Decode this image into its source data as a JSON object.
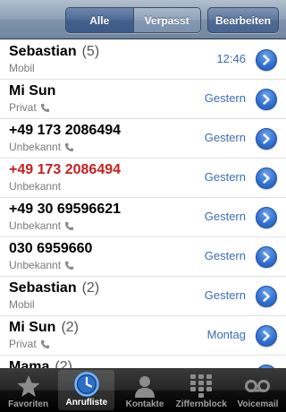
{
  "navbar": {
    "segments": [
      "Alle",
      "Verpasst"
    ],
    "active_segment": "Alle",
    "edit_label": "Bearbeiten"
  },
  "calls": [
    {
      "name": "Sebastian",
      "count": "(5)",
      "type": "Mobil",
      "icon": "",
      "time": "12:46",
      "missed": false
    },
    {
      "name": "Mi Sun",
      "count": "",
      "type": "Privat",
      "icon": "phone-icon",
      "time": "Gestern",
      "missed": false
    },
    {
      "name": "+49 173 2086494",
      "count": "",
      "type": "Unbekannt",
      "icon": "phone-icon",
      "time": "Gestern",
      "missed": false
    },
    {
      "name": "+49 173 2086494",
      "count": "",
      "type": "Unbekannt",
      "icon": "",
      "time": "Gestern",
      "missed": true
    },
    {
      "name": "+49 30 69596621",
      "count": "",
      "type": "Unbekannt",
      "icon": "phone-icon",
      "time": "Gestern",
      "missed": false
    },
    {
      "name": "030 6959660",
      "count": "",
      "type": "Unbekannt",
      "icon": "phone-icon",
      "time": "Gestern",
      "missed": false
    },
    {
      "name": "Sebastian",
      "count": "(2)",
      "type": "Mobil",
      "icon": "",
      "time": "Gestern",
      "missed": false
    },
    {
      "name": "Mi Sun",
      "count": "(2)",
      "type": "Privat",
      "icon": "phone-icon",
      "time": "Montag",
      "missed": false
    },
    {
      "name": "Mama",
      "count": "(2)",
      "type": "",
      "icon": "",
      "time": "",
      "missed": false
    }
  ],
  "colors": {
    "missed": "#c41f1f",
    "time": "#3b6cb3",
    "chevron": "#2f6fd1"
  },
  "tabs": [
    {
      "label": "Favoriten",
      "icon": "star-icon",
      "selected": false
    },
    {
      "label": "Anrufliste",
      "icon": "clock-icon",
      "selected": true
    },
    {
      "label": "Kontakte",
      "icon": "contact-icon",
      "selected": false
    },
    {
      "label": "Ziffernblock",
      "icon": "keypad-icon",
      "selected": false
    },
    {
      "label": "Voicemail",
      "icon": "voicemail-icon",
      "selected": false
    }
  ]
}
